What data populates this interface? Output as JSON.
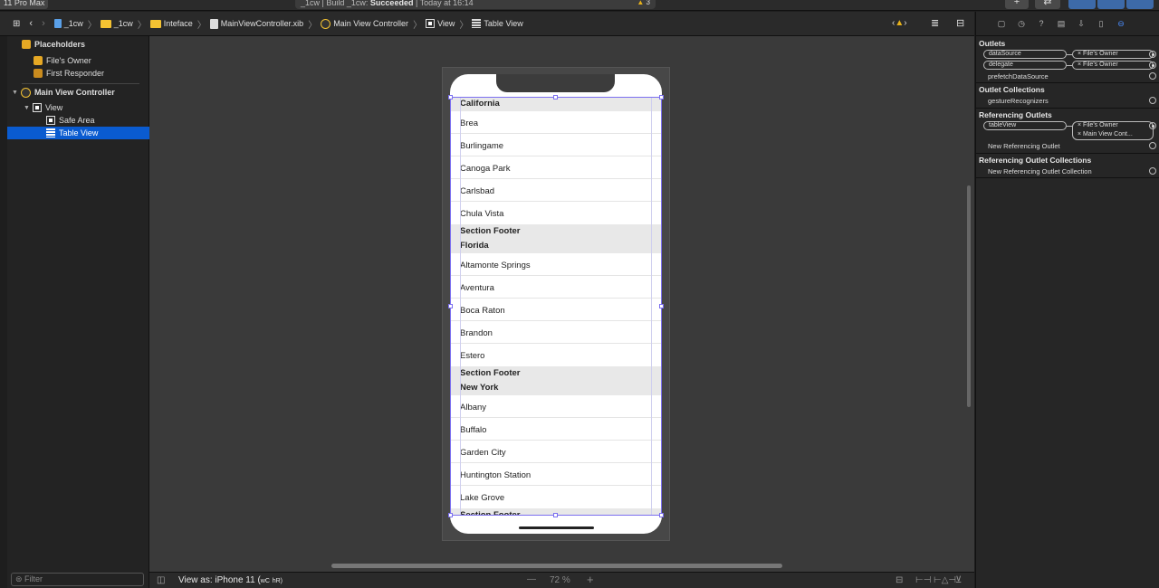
{
  "titlebar": {
    "scheme": "11 Pro Max",
    "status_project": "_1cw",
    "status_build_prefix": "| Build _1cw:",
    "status_result": "Succeeded",
    "status_time": "| Today at 16:14",
    "warning_count": "3",
    "plus_label": "+",
    "swap_label": "⇄"
  },
  "jumpbar": {
    "crumbs": [
      "_1cw",
      "_1cw",
      "Inteface",
      "MainViewController.xib",
      "Main View Controller",
      "View",
      "Table View"
    ]
  },
  "outline": {
    "placeholders": "Placeholders",
    "files_owner": "File's Owner",
    "first_responder": "First Responder",
    "main_view_controller": "Main View Controller",
    "view": "View",
    "safe_area": "Safe Area",
    "table_view": "Table View",
    "filter_placeholder": "Filter"
  },
  "table": {
    "sections": [
      {
        "header": "California",
        "rows": [
          "Brea",
          "Burlingame",
          "Canoga Park",
          "Carlsbad",
          "Chula Vista"
        ],
        "footer": "Section Footer"
      },
      {
        "header": "Florida",
        "rows": [
          "Altamonte Springs",
          "Aventura",
          "Boca Raton",
          "Brandon",
          "Estero"
        ],
        "footer": "Section Footer"
      },
      {
        "header": "New York",
        "rows": [
          "Albany",
          "Buffalo",
          "Garden City",
          "Huntington Station",
          "Lake Grove"
        ],
        "footer": "Section Footer"
      }
    ]
  },
  "bottombar": {
    "view_as": "View as: iPhone 11 (",
    "view_as_trait1": "wC",
    "view_as_trait2": "hR)",
    "zoom_minus": "—",
    "zoom": "72 %",
    "zoom_plus": "+"
  },
  "inspector": {
    "outlets": "Outlets",
    "datasource": "dataSource",
    "delegate": "delegate",
    "files_owner": "File's Owner",
    "prefetch": "prefetchDataSource",
    "outlet_collections": "Outlet Collections",
    "gesture": "gestureRecognizers",
    "referencing_outlets": "Referencing Outlets",
    "tableview": "tableView",
    "main_view_cont": "Main View Cont...",
    "new_ref_outlet": "New Referencing Outlet",
    "ref_outlet_collections": "Referencing Outlet Collections",
    "new_ref_collection": "New Referencing Outlet Collection",
    "x_mark": "×"
  },
  "colors": {
    "selection": "#0a5bd0",
    "accent_outline": "#7b6ff0",
    "warning": "#e8b21a",
    "folder": "#f4c232"
  }
}
